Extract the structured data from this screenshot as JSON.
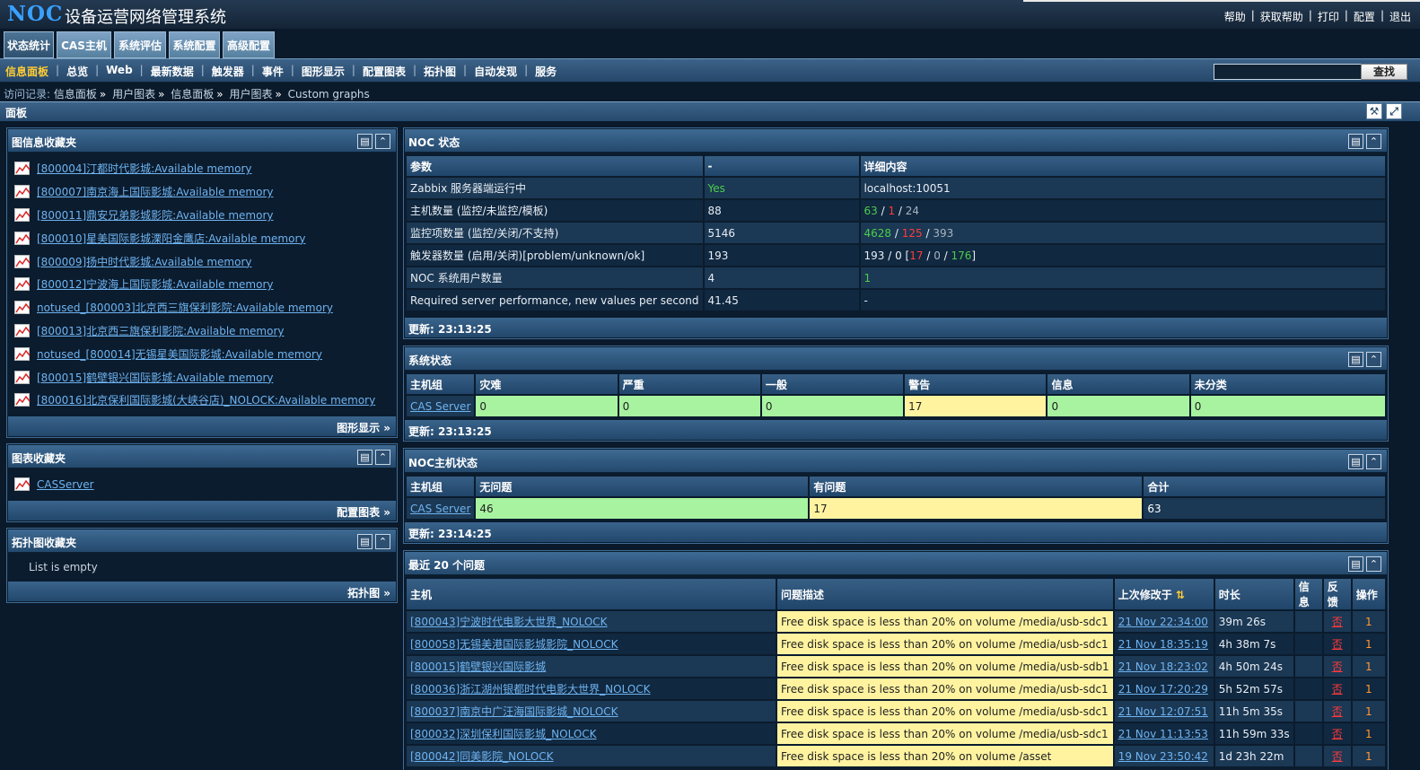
{
  "header": {
    "logo": "NOC",
    "subtitle": "设备运营网络管理系统",
    "links": [
      "帮助",
      "获取帮助",
      "打印",
      "配置",
      "退出"
    ]
  },
  "main_tabs": [
    "状态统计",
    "CAS主机",
    "系统评估",
    "系统配置",
    "高级配置"
  ],
  "subnav": {
    "items": [
      "信息面板",
      "总览",
      "Web",
      "最新数据",
      "触发器",
      "事件",
      "图形显示",
      "配置图表",
      "拓扑图",
      "自动发现",
      "服务"
    ],
    "search_button": "查找"
  },
  "breadcrumb": {
    "lead": "访问记录:",
    "items": [
      "信息面板",
      "用户图表",
      "信息面板",
      "用户图表",
      "Custom graphs"
    ]
  },
  "panel": {
    "title": "面板"
  },
  "graph_favorites": {
    "title": "图信息收藏夹",
    "items": [
      "[800004]汀都时代影城:Available memory",
      "[800007]南京海上国际影城:Available memory",
      "[800011]鼎安兄弟影城影院:Available memory",
      "[800010]星美国际影城溧阳金鹰店:Available memory",
      "[800009]扬中时代影城:Available memory",
      "[800012]宁波海上国际影城:Available memory",
      "notused_[800003]北京西三旗保利影院:Available memory",
      "[800013]北京西三旗保利影院:Available memory",
      "notused_[800014]无锡星美国际影城:Available memory",
      "[800015]鹤壁银兴国际影城:Available memory",
      "[800016]北京保利国际影城(大峡谷店)_NOLOCK:Available memory"
    ],
    "footer": "图形显示 »"
  },
  "chart_favorites": {
    "title": "图表收藏夹",
    "items": [
      "CASServer"
    ],
    "footer": "配置图表 »"
  },
  "map_favorites": {
    "title": "拓扑图收藏夹",
    "empty": "List is empty",
    "footer": "拓扑图 »"
  },
  "noc_status": {
    "title": "NOC 状态",
    "headers": [
      "参数",
      "-",
      "详细内容"
    ],
    "rows": [
      {
        "param": "Zabbix 服务器端运行中",
        "value": "Yes",
        "detail": "localhost:10051"
      },
      {
        "param": "主机数量 (监控/未监控/模板)",
        "value": "88",
        "d1": "63",
        "d2": "1",
        "d3": "24"
      },
      {
        "param": "监控项数量 (监控/关闭/不支持)",
        "value": "5146",
        "d1": "4628",
        "d2": "125",
        "d3": "393"
      },
      {
        "param": "触发器数量 (启用/关闭)[problem/unknown/ok]",
        "value": "193",
        "d0": "193 / 0",
        "d1": "17",
        "d2": "0",
        "d3": "176"
      },
      {
        "param": "NOC 系统用户数量",
        "value": "4",
        "detail": "1"
      },
      {
        "param": "Required server performance, new values per second",
        "value": "41.45",
        "detail": "-"
      }
    ],
    "updated": "更新: 23:13:25"
  },
  "system_status": {
    "title": "系统状态",
    "headers": [
      "主机组",
      "灾难",
      "严重",
      "一般",
      "警告",
      "信息",
      "未分类"
    ],
    "row": {
      "group": "CAS Server",
      "values": [
        "0",
        "0",
        "0",
        "17",
        "0",
        "0"
      ]
    },
    "updated": "更新: 23:13:25"
  },
  "host_status": {
    "title": "NOC主机状态",
    "headers": [
      "主机组",
      "无问题",
      "有问题",
      "合计"
    ],
    "row": {
      "group": "CAS Server",
      "ok": "46",
      "problem": "17",
      "total": "63"
    },
    "updated": "更新: 23:14:25"
  },
  "last_issues": {
    "title": "最近 20 个问题",
    "headers": [
      "主机",
      "问题描述",
      "上次修改于",
      "时长",
      "信息",
      "反馈",
      "操作"
    ],
    "rows": [
      {
        "host": "[800043]宁波时代电影大世界_NOLOCK",
        "issue": "Free disk space is less than 20% on volume /media/usb-sdc1",
        "changed": "21 Nov 22:34:00",
        "duration": "39m 26s",
        "ack": "否",
        "actions": "1"
      },
      {
        "host": "[800058]无锡美港国际影城影院_NOLOCK",
        "issue": "Free disk space is less than 20% on volume /media/usb-sdc1",
        "changed": "21 Nov 18:35:19",
        "duration": "4h 38m 7s",
        "ack": "否",
        "actions": "1"
      },
      {
        "host": "[800015]鹤壁银兴国际影城",
        "issue": "Free disk space is less than 20% on volume /media/usb-sdb1",
        "changed": "21 Nov 18:23:02",
        "duration": "4h 50m 24s",
        "ack": "否",
        "actions": "1"
      },
      {
        "host": "[800036]浙江湖州银都时代电影大世界_NOLOCK",
        "issue": "Free disk space is less than 20% on volume /media/usb-sdc1",
        "changed": "21 Nov 17:20:29",
        "duration": "5h 52m 57s",
        "ack": "否",
        "actions": "1"
      },
      {
        "host": "[800037]南京中广汪海国际影城_NOLOCK",
        "issue": "Free disk space is less than 20% on volume /media/usb-sdc1",
        "changed": "21 Nov 12:07:51",
        "duration": "11h 5m 35s",
        "ack": "否",
        "actions": "1"
      },
      {
        "host": "[800032]深圳保利国际影城_NOLOCK",
        "issue": "Free disk space is less than 20% on volume /media/usb-sdc1",
        "changed": "21 Nov 11:13:53",
        "duration": "11h 59m 33s",
        "ack": "否",
        "actions": "1"
      },
      {
        "host": "[800042]同美影院_NOLOCK",
        "issue": "Free disk space is less than 20% on volume /asset",
        "changed": "19 Nov 23:50:42",
        "duration": "1d 23h 22m",
        "ack": "否",
        "actions": "1"
      }
    ]
  },
  "colors": {
    "background": "#0a1a2b",
    "header": "#243a52",
    "link": "#6fb3f0",
    "ok_cell": "#a8f3a0",
    "warn_cell": "#fff3a0",
    "active_nav": "#ffcc33"
  }
}
